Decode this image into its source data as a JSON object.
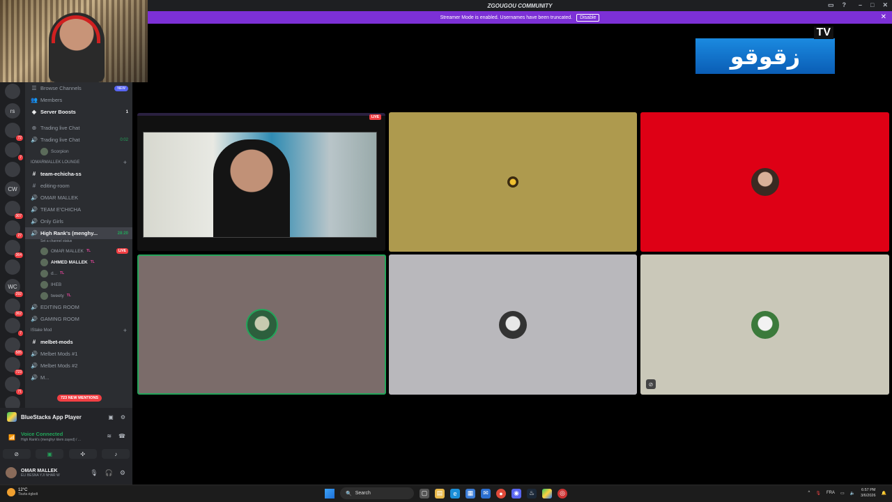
{
  "window": {
    "title": "ZGOUGOU COMMUNITY"
  },
  "streamer_banner": {
    "text": "Streamer Mode is enabled. Usernames have been truncated.",
    "disable_label": "Disable",
    "close": "✕"
  },
  "server_rail": {
    "servers": [
      {
        "label": "",
        "badge": ""
      },
      {
        "label": "rs",
        "badge": ""
      },
      {
        "label": "",
        "badge": "72"
      },
      {
        "label": "",
        "badge": "7"
      },
      {
        "label": "",
        "badge": ""
      },
      {
        "label": "CW",
        "badge": ""
      },
      {
        "label": "",
        "badge": "307"
      },
      {
        "label": "",
        "badge": "27"
      },
      {
        "label": "",
        "badge": "364"
      },
      {
        "label": "",
        "badge": ""
      },
      {
        "label": "WC",
        "badge": "292"
      },
      {
        "label": "",
        "badge": "362"
      },
      {
        "label": "",
        "badge": "7"
      },
      {
        "label": "",
        "badge": "585"
      },
      {
        "label": "",
        "badge": "723"
      },
      {
        "label": "",
        "badge": "71"
      },
      {
        "label": "",
        "badge": "216"
      },
      {
        "label": "",
        "badge": ""
      },
      {
        "label": "",
        "badge": ""
      }
    ],
    "new_label": "NEW"
  },
  "sidebar": {
    "browse": "Browse Channels",
    "browse_badge": "NEW",
    "members": "Members",
    "boosts": "Server Boosts",
    "boosts_count": "1",
    "trading_live_chat_text": "Trading live Chat",
    "trading_live_chat_voice": "Trading live Chat",
    "trading_timer": "0:02",
    "scorpion": "Scorpion",
    "cat1": "IOMARMALLEK LOUNGE",
    "team_echicha": "team-echicha-ss",
    "editing_room_text": "editing-room",
    "omar_mallek": "OMAR MALLEK",
    "team_echicha_voice": "TEAM E'CHICHA",
    "only_girls": "Only Girls",
    "high_rank": "High Rank's (menghy...",
    "high_rank_timer": "28:20",
    "channel_status": "Set a channel status",
    "members_in_call": [
      {
        "name": "OMAR MALLEK",
        "tag": "TL",
        "live": "LIVE",
        "bold": false
      },
      {
        "name": "AHMED MALLEK",
        "tag": "TL",
        "live": "",
        "bold": true
      },
      {
        "name": "d...",
        "tag": "TL",
        "live": "",
        "bold": false
      },
      {
        "name": "IHEB",
        "tag": "",
        "live": "",
        "bold": false
      },
      {
        "name": "tweety",
        "tag": "TL",
        "live": "",
        "bold": false
      }
    ],
    "editing_room_voice": "EDITING ROOM",
    "gaming_room": "GAMING ROOM",
    "cat2": "IStake Mod",
    "melbet_mods": "melbet-mods",
    "melbet_1": "Melbet Mods #1",
    "melbet_2": "Melbet Mods #2",
    "melbet_3": "M...",
    "new_mentions": "723 NEW MENTIONS"
  },
  "activity": {
    "app": "BlueStacks App Player"
  },
  "voice": {
    "status": "Voice Connected",
    "channel": "High Rank's (menghyr klem zayed) / ..."
  },
  "user": {
    "name": "OMAR MALLEK",
    "status": "ELI BESNA YJI NHAR W"
  },
  "stage": {
    "live_label": "LIVE"
  },
  "logo": {
    "arabic": "زقوقو",
    "tv": "TV"
  },
  "taskbar": {
    "weather_temp": "12°C",
    "weather_desc": "Tiszta égbolt",
    "search": "Search",
    "lang": "FRA",
    "time": "6:57 PM",
    "date": "3/6/2026"
  }
}
